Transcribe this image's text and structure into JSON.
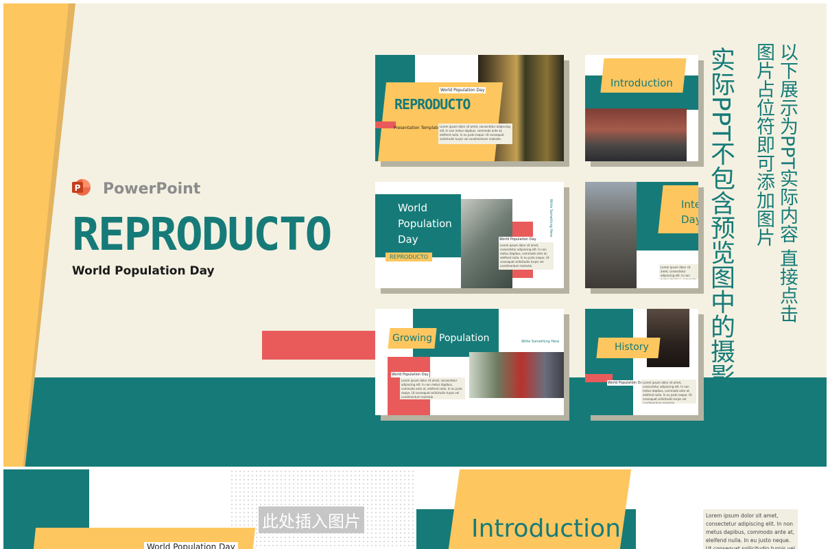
{
  "hero": {
    "app_name": "PowerPoint",
    "title": "REPRODUCTO",
    "subtitle": "World Population Day"
  },
  "vertical_notes": {
    "note_small": "以下展示为PPT实际内容 直接点击图片占位符即可添加图片",
    "note_large": "实际PPT不包含预览图中的摄影图"
  },
  "thumbs": {
    "t1": {
      "badge": "World Population Day",
      "title": "REPRODUCTO",
      "tag": "Presentation Template"
    },
    "t2": {
      "title": "Introduction"
    },
    "t3": {
      "title": "World Population Day",
      "badge": "REPRODUCTO",
      "side": "Write Something Here",
      "label": "World Population Day"
    },
    "t4": {
      "title_partial_1": "Inte",
      "title_partial_2": "Day"
    },
    "t5": {
      "word1": "Growing",
      "word2": "Population",
      "side": "Write Something Here",
      "label": "World Population Day"
    },
    "t6": {
      "title": "History",
      "label": "World Population Day"
    }
  },
  "lorem": "Lorem ipsum dolor sit amet, consectetur adipiscing elit. In non metus dapibus, commodo ante at, eleifend nulla. In eu justo neque. Ut consequat sollicitudin turpis vel condimentum molestie.",
  "bottom": {
    "placeholder": "此处插入图片",
    "badge": "World Population Day",
    "intro": "Introduction"
  },
  "colors": {
    "teal": "#167b78",
    "yellow": "#fdc65f",
    "red": "#e85b5a",
    "cream": "#f4f1e2"
  }
}
